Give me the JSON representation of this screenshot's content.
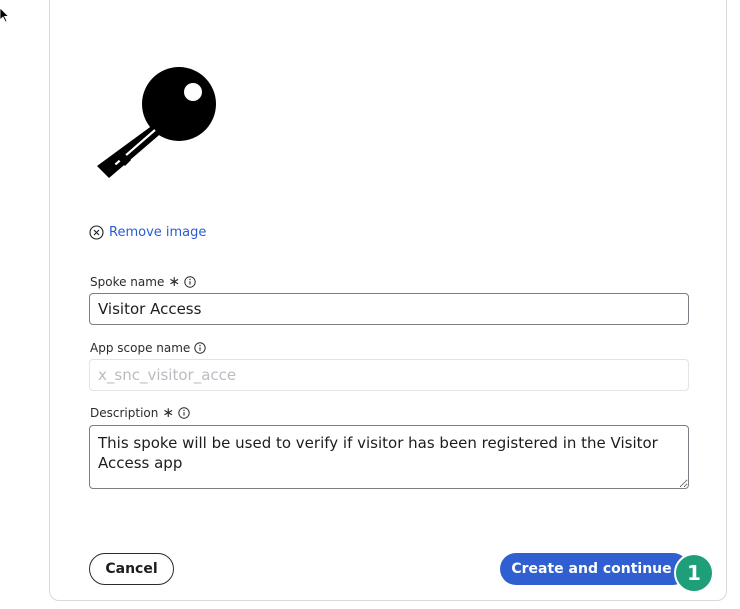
{
  "form": {
    "key_image_icon": "key-icon",
    "remove_image_label": "Remove image",
    "spoke_name": {
      "label": "Spoke name",
      "required_mark": "∗",
      "value": "Visitor Access"
    },
    "app_scope_name": {
      "label": "App scope name",
      "value": "x_snc_visitor_acce"
    },
    "description": {
      "label": "Description",
      "required_mark": "∗",
      "value": "This spoke will be used to verify if visitor has been registered in the Visitor Access app"
    }
  },
  "actions": {
    "cancel_label": "Cancel",
    "create_label": "Create and continue"
  },
  "annotation": {
    "step_number": "1",
    "color": "#1f9e7a"
  },
  "colors": {
    "primary_button": "#2f5fd0",
    "link": "#2a5bd7"
  }
}
